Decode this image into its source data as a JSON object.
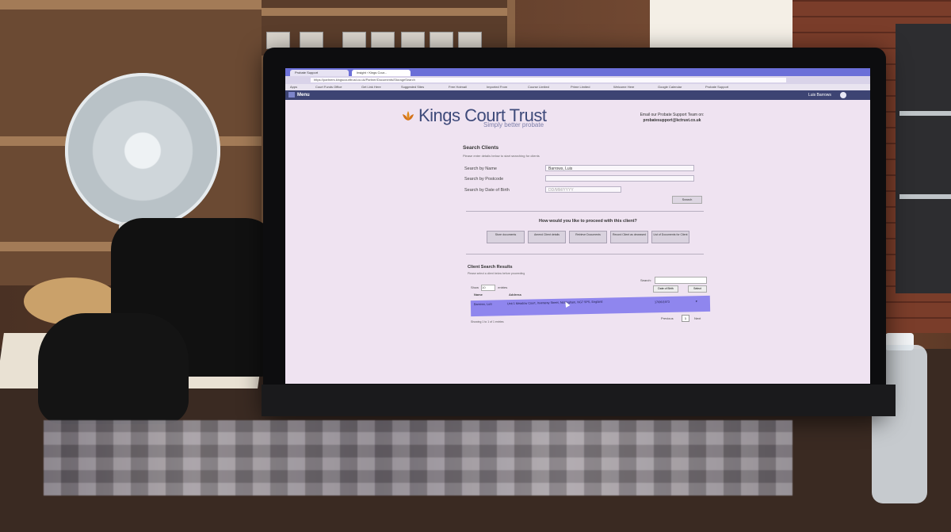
{
  "browser": {
    "tabs": [
      {
        "label": "Probate Support"
      },
      {
        "label": "Insight › Kings Cour..."
      }
    ],
    "url": "https://partners.kingscourttrust.co.uk/Partner/Documents/StorageSearch",
    "bookmarks": [
      "Apps",
      "Court Funds Office",
      "Get Link Here",
      "Suggested Sites",
      "Free Hotmail",
      "Imported From",
      "Course Limited",
      "Prime Limited",
      "Welcome Here",
      "Google Calendar",
      "Probate Support"
    ]
  },
  "app": {
    "menu_label": "Menu",
    "user_name": "Luis Barrows"
  },
  "brand": {
    "name": "Kings Court Trust",
    "tagline": "Simply better probate",
    "colors": {
      "primary": "#3e4a7a",
      "appbar": "#3d4473",
      "selection": "#8f86ee",
      "logo_orange": "#e08a1a"
    }
  },
  "support": {
    "line1": "Email our Probate Support Team on:",
    "email": "probatesupport@kctrust.co.uk"
  },
  "search_clients": {
    "title": "Search Clients",
    "subtitle": "Please enter details below to start searching for clients",
    "fields": [
      {
        "label": "Search by Name",
        "value": "Barrows, Luis",
        "placeholder": ""
      },
      {
        "label": "Search by Postcode",
        "value": "",
        "placeholder": ""
      },
      {
        "label": "Search by Date of Birth",
        "value": "",
        "placeholder": "DD/MM/YYYY"
      }
    ],
    "search_button": "Search"
  },
  "proceed": {
    "question": "How would you like to proceed with this client?",
    "actions": [
      "Store documents",
      "Amend Client details",
      "Retrieve Documents",
      "Record Client as deceased",
      "List of Documents for Client"
    ]
  },
  "results": {
    "title": "Client Search Results",
    "subtitle": "Please select a client below before proceeding",
    "show_label": "Show",
    "show_value": "10",
    "entries_label": "entries",
    "search_label": "Search:",
    "dob_button": "Date of Birth",
    "select_button": "Select",
    "columns": [
      "Name",
      "Address"
    ],
    "rows": [
      {
        "name": "Barrows, Luis",
        "address": "Unit 1 Meadow Court, Inveraray Street, Nottingham, NG7 5PS, England",
        "dob": "17/06/1973"
      }
    ],
    "previous": "Previous",
    "page": "1",
    "next": "Next",
    "showing": "Showing 1 to 1 of 1 entries"
  }
}
